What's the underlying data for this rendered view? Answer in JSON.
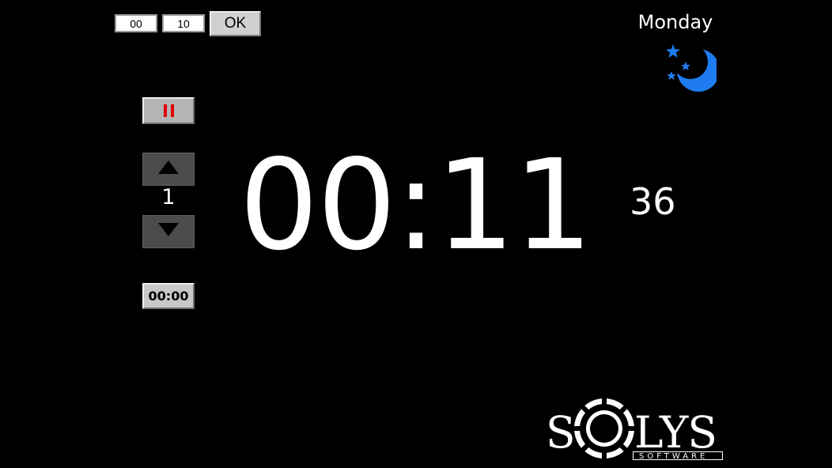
{
  "alarm": {
    "hours_value": "00",
    "minutes_value": "10",
    "ok_label": "OK"
  },
  "header": {
    "day": "Monday",
    "night_icon": "moon-stars-icon",
    "night_icon_color": "#1e7cf0"
  },
  "controls": {
    "pause_icon": "pause-icon",
    "pause_color": "#e00000",
    "up_icon": "arrow-up-icon",
    "step_value": "1",
    "down_icon": "arrow-down-icon",
    "reset_label": "00:00"
  },
  "clock": {
    "main_time": "00:11",
    "seconds": "36"
  },
  "logo": {
    "text_left": "S",
    "text_right": "LYS",
    "subtitle": "SOFTWARE"
  }
}
